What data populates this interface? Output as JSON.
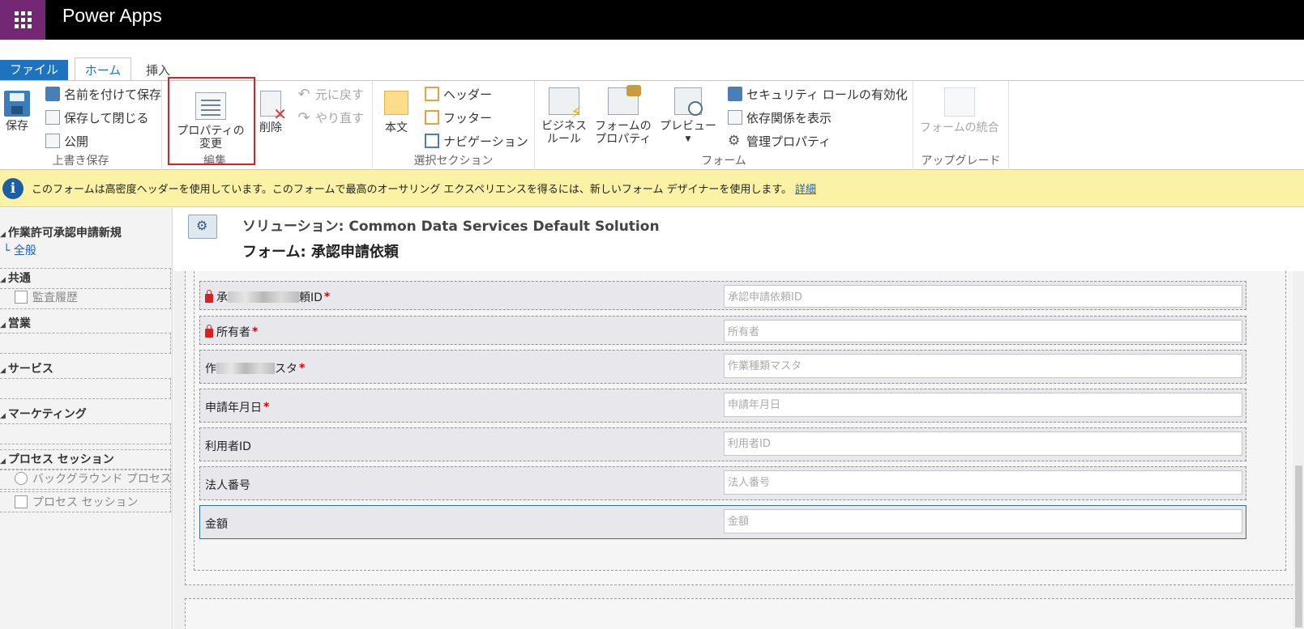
{
  "app": {
    "title": "Power Apps"
  },
  "tabs": {
    "file": "ファイル",
    "home": "ホーム",
    "insert": "挿入"
  },
  "ribbon": {
    "save_group": {
      "save": "保存",
      "save_as": "名前を付けて保存",
      "save_close": "保存して閉じる",
      "publish": "公開",
      "label": "上書き保存"
    },
    "props": {
      "line1": "プロパティの",
      "line2": "変更"
    },
    "edit_group": {
      "delete": "削除",
      "undo": "元に戻す",
      "redo": "やり直す",
      "label": "編集"
    },
    "select_group": {
      "body": "本文",
      "header": "ヘッダー",
      "footer": "フッター",
      "navigation": "ナビゲーション",
      "label": "選択セクション"
    },
    "form_group": {
      "biz_line1": "ビジネス",
      "biz_line2": "ルール",
      "formprop_line1": "フォームの",
      "formprop_line2": "プロパティ",
      "preview": "プレビュー",
      "security": "セキュリティ ロールの有効化",
      "dependencies": "依存関係を表示",
      "managed": "管理プロパティ",
      "label": "フォーム"
    },
    "upgrade_group": {
      "merge": "フォームの統合",
      "label": "アップグレード"
    }
  },
  "infobar": {
    "text": "このフォームは高密度ヘッダーを使用しています。このフォームで最高のオーサリング エクスペリエンスを得るには、新しいフォーム デザイナーを使用します。",
    "link": "詳細"
  },
  "leftnav": {
    "entity": "作業許可承認申請新規",
    "general": "全般",
    "groups": [
      {
        "label": "共通",
        "items": [
          "監査履歴"
        ]
      },
      {
        "label": "営業",
        "items": []
      },
      {
        "label": "サービス",
        "items": []
      },
      {
        "label": "マーケティング",
        "items": []
      },
      {
        "label": "プロセス セッション",
        "items": [
          "バックグラウンド プロセス",
          "プロセス セッション"
        ]
      }
    ]
  },
  "header": {
    "solution": "ソリューション: Common Data Services Default Solution",
    "form": "フォーム: 承認申請依頼"
  },
  "fields": [
    {
      "label_pre": "承",
      "label_post": "頼ID",
      "placeholder": "承認申請依頼ID",
      "required": "*"
    },
    {
      "label": "所有者",
      "placeholder": "所有者",
      "required": "*"
    },
    {
      "label_pre": "作",
      "label_post": "スタ",
      "placeholder": "作業種類マスタ",
      "required": "*"
    },
    {
      "label": "申請年月日",
      "placeholder": "申請年月日",
      "required": "*"
    },
    {
      "label": "利用者ID",
      "placeholder": "利用者ID"
    },
    {
      "label": "法人番号",
      "placeholder": "法人番号"
    },
    {
      "label": "金額",
      "placeholder": "金額"
    }
  ],
  "colors": {
    "brand": "#742774",
    "file_tab": "#1e73be",
    "info_bg": "#fcf2a6",
    "highlight": "#e02020"
  }
}
